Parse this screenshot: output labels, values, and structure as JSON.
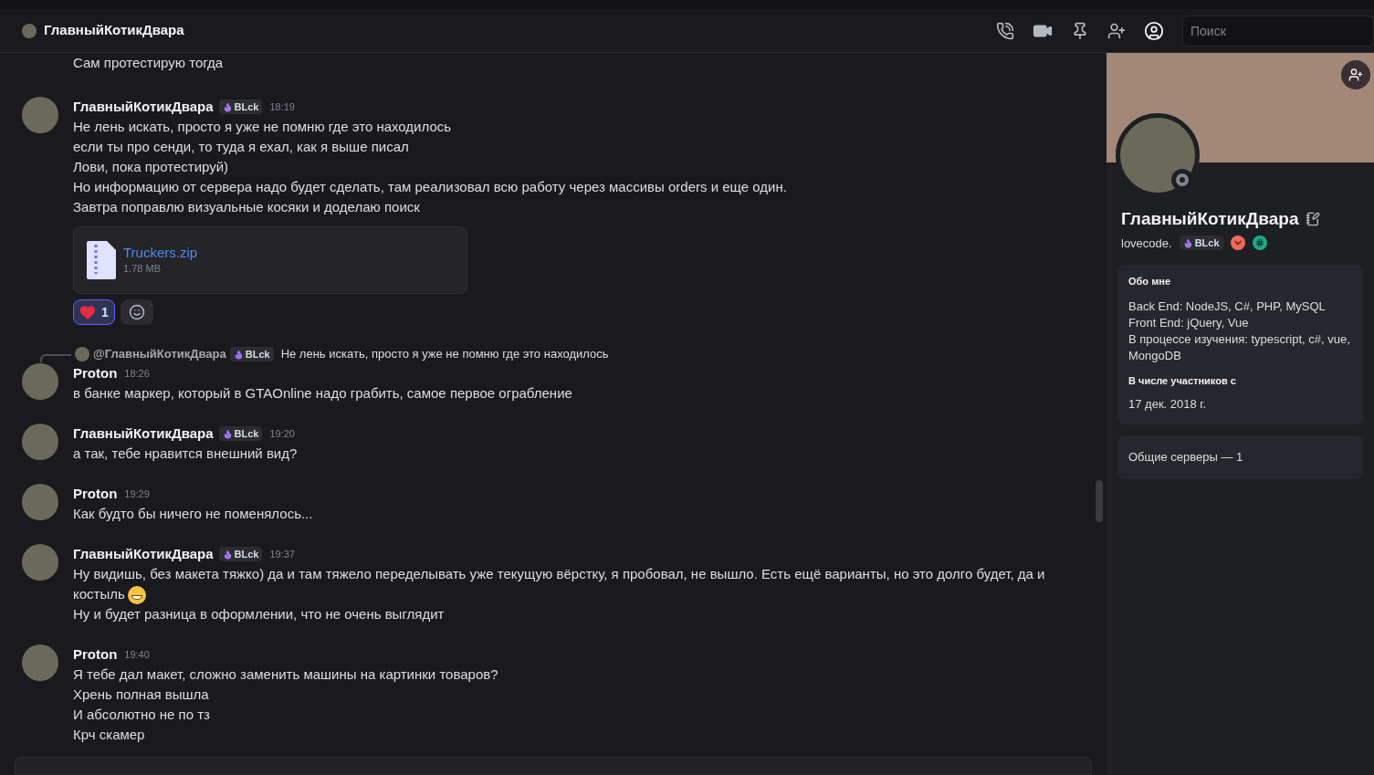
{
  "header": {
    "title": "ГлавныйКотикДвара",
    "search_placeholder": "Поиск"
  },
  "messages": [
    {
      "kind": "continuation",
      "lines": [
        {
          "text": "Сам протестирую тогда",
          "emoji": false
        }
      ]
    },
    {
      "kind": "group",
      "author": "ГлавныйКотикДвара",
      "badge": "BLck",
      "time": "18:19",
      "lines": [
        {
          "text": "Не лень искать, просто я уже не помню где это находилось",
          "emoji": false
        },
        {
          "text": "если ты про сенди, то туда я ехал, как я выше писал",
          "emoji": false
        },
        {
          "text": "Лови, пока протестируй)",
          "emoji": false
        },
        {
          "text": "Но информацию от сервера надо будет сделать, там реализовал всю работу через массивы orders и еще один.",
          "emoji": false
        },
        {
          "text": "Завтра поправлю визуальные косяки и доделаю поиск",
          "emoji": false
        }
      ],
      "attachment": {
        "name": "Truckers.zip",
        "size": "1.78 MB"
      },
      "reactions": [
        {
          "count": "1",
          "selected": true
        }
      ]
    },
    {
      "kind": "group",
      "reply": {
        "author": "@ГлавныйКотикДвара",
        "badge": "BLck",
        "text": "Не лень искать, просто я уже не помню где это находилось"
      },
      "author": "Proton",
      "time": "18:26",
      "lines": [
        {
          "text": "в банке маркер, который в GTAOnline надо грабить, самое первое ограбление",
          "emoji": false
        }
      ]
    },
    {
      "kind": "group",
      "author": "ГлавныйКотикДвара",
      "badge": "BLck",
      "time": "19:20",
      "lines": [
        {
          "text": "а так, тебе нравится внешний вид?",
          "emoji": false
        }
      ]
    },
    {
      "kind": "group",
      "author": "Proton",
      "time": "19:29",
      "lines": [
        {
          "text": "Как будто бы ничего не поменялось...",
          "emoji": false
        }
      ]
    },
    {
      "kind": "group",
      "author": "ГлавныйКотикДвара",
      "badge": "BLck",
      "time": "19:37",
      "lines": [
        {
          "text": "Ну видишь, без макета тяжко) да и там тяжело переделывать уже текущую вёрстку, я пробовал, не вышло. Есть ещё варианты, но это долго будет, да и костыль",
          "emoji": true
        },
        {
          "text": "Ну и будет разница в оформлении, что не очень выглядит",
          "emoji": false
        }
      ]
    },
    {
      "kind": "group",
      "author": "Proton",
      "time": "19:40",
      "lines": [
        {
          "text": "Я тебе дал макет, сложно заменить машины на картинки товаров?",
          "emoji": false
        },
        {
          "text": "Хрень полная вышла",
          "emoji": false
        },
        {
          "text": "И абсолютно не по тз",
          "emoji": false
        },
        {
          "text": "Крч скамер",
          "emoji": false
        }
      ]
    }
  ],
  "profile": {
    "name": "ГлавныйКотикДвара",
    "username": "lovecode.",
    "badge": "BLck",
    "about_title": "Обо мне",
    "about_lines": [
      "Back End: NodeJS, C#, PHP, MySQL",
      "Front End: jQuery, Vue",
      "В процессе изучения: typescript, c#, vue, MongoDB"
    ],
    "member_since_title": "В числе участников с",
    "member_since": "17 дек. 2018 г.",
    "mutual_servers": "Общие серверы — 1"
  }
}
